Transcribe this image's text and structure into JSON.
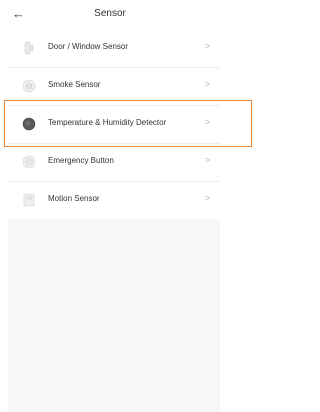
{
  "header": {
    "back_icon": "arrow-left-icon",
    "title": "Sensor"
  },
  "items": [
    {
      "label": "Door / Window Sensor",
      "icon": "door-window-sensor-icon"
    },
    {
      "label": "Smoke Sensor",
      "icon": "smoke-sensor-icon"
    },
    {
      "label": "Temperature & Humidity Detector",
      "icon": "temperature-humidity-icon"
    },
    {
      "label": "Emergency Button",
      "icon": "emergency-button-icon"
    },
    {
      "label": "Motion Sensor",
      "icon": "motion-sensor-icon"
    }
  ],
  "highlight": {
    "target": "Temperature & Humidity Detector",
    "color": "#f08a3c"
  }
}
